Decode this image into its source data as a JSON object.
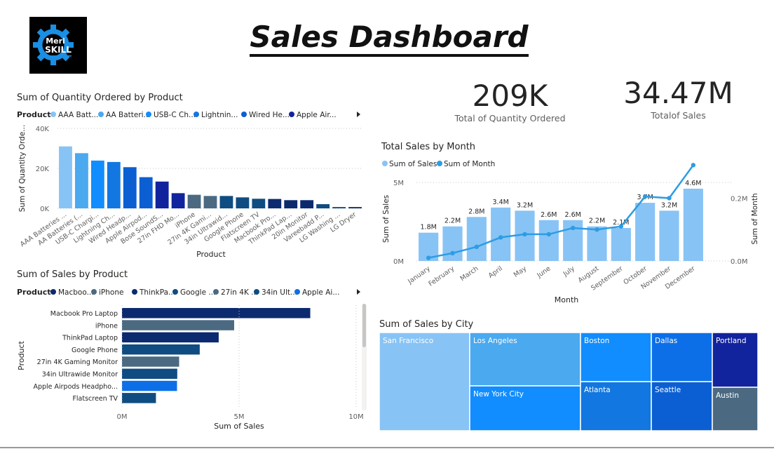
{
  "header": {
    "title": "Sales Dashboard",
    "logo_line1": "Meri",
    "logo_line2": "SKILL"
  },
  "kpis": [
    {
      "value": "209K",
      "label": "Total of Quantity Ordered"
    },
    {
      "value": "34.47M",
      "label": "Totalof Sales"
    }
  ],
  "colors": {
    "light": "#88c3f5",
    "c2": "#4aa9ef",
    "c3": "#118dff",
    "c4": "#1277e0",
    "c5": "#0b5fd2",
    "navy": "#12239e",
    "dark_navy": "#0c2a6f",
    "slate": "#4b6a82",
    "teal": "#0f4c81",
    "line": "#2d9de3",
    "accent_blue": "#0d6fe8"
  },
  "chart_data": [
    {
      "id": "qty",
      "type": "bar",
      "title": "Sum of Quantity Ordered by Product",
      "legend_title": "Product",
      "legend": [
        "AAA Batt...",
        "AA Batteri...",
        "USB-C Ch...",
        "Lightnin...",
        "Wired He...",
        "Apple Air..."
      ],
      "categories": [
        "AAA Batteries ...",
        "AA Batteries (...",
        "USB-C Chargi...",
        "Lightning Ch...",
        "Wired Headp...",
        "Apple Airpod...",
        "Bose SoundS...",
        "27in FHD Mo...",
        "iPhone",
        "27in 4K Gami...",
        "34in Ultrawid...",
        "Google Phone",
        "Flatscreen TV",
        "Macbook Pro...",
        "ThinkPad Lap...",
        "20in Monitor",
        "Vareebadd P...",
        "LG Washing ...",
        "LG Dryer"
      ],
      "values": [
        31000,
        27600,
        23900,
        23200,
        20600,
        15600,
        13400,
        7600,
        6800,
        6200,
        6200,
        5500,
        4800,
        4700,
        4100,
        4100,
        2100,
        660,
        650
      ],
      "xlabel": "Product",
      "ylabel": "Sum of Quantity Orde...",
      "yticks": [
        "0K",
        "20K",
        "40K"
      ],
      "ylim": [
        0,
        40000
      ]
    },
    {
      "id": "month",
      "type": "bar",
      "title": "Total Sales by Month",
      "legend": [
        "Sum of Sales",
        "Sum of Month"
      ],
      "categories": [
        "January",
        "February",
        "March",
        "April",
        "May",
        "June",
        "July",
        "August",
        "September",
        "October",
        "November",
        "December"
      ],
      "series": [
        {
          "name": "Sum of Sales",
          "type": "bar",
          "values": [
            1.8,
            2.2,
            2.8,
            3.4,
            3.2,
            2.6,
            2.6,
            2.2,
            2.1,
            3.7,
            3.2,
            4.6
          ],
          "labels": [
            "1.8M",
            "2.2M",
            "2.8M",
            "3.4M",
            "3.2M",
            "2.6M",
            "2.6M",
            "2.2M",
            "2.1M",
            "3.7M",
            "3.2M",
            "4.6M"
          ]
        },
        {
          "name": "Sum of Month",
          "type": "line",
          "values": [
            0.01,
            0.025,
            0.045,
            0.075,
            0.085,
            0.085,
            0.105,
            0.1,
            0.11,
            0.205,
            0.2,
            0.305
          ]
        }
      ],
      "xlabel": "Month",
      "ylabel": "Sum of Sales",
      "y2label": "Sum of Month",
      "yticks": [
        "0M",
        "5M"
      ],
      "y2ticks": [
        "0.0M",
        "0.2M"
      ],
      "ylim": [
        0,
        5
      ],
      "y2lim": [
        0,
        0.25
      ]
    },
    {
      "id": "salesprod",
      "type": "bar",
      "orientation": "horizontal",
      "title": "Sum of Sales by Product",
      "legend_title": "Product",
      "legend": [
        "Macboo...",
        "iPhone",
        "ThinkPa...",
        "Google ...",
        "27in 4K ...",
        "34in Ult...",
        "Apple Ai..."
      ],
      "categories": [
        "Macbook Pro Laptop",
        "iPhone",
        "ThinkPad Laptop",
        "Google Phone",
        "27in 4K Gaming Monitor",
        "34in Ultrawide Monitor",
        "Apple Airpods Headpho...",
        "Flatscreen TV"
      ],
      "values": [
        8.04,
        4.79,
        4.13,
        3.32,
        2.44,
        2.36,
        2.35,
        1.45
      ],
      "xlabel": "Sum of Sales",
      "ylabel": "Product",
      "xticks": [
        "0M",
        "5M",
        "10M"
      ],
      "xlim": [
        0,
        10
      ]
    },
    {
      "id": "city",
      "type": "treemap",
      "title": "Sum of Sales by City",
      "cells": [
        {
          "name": "San Francisco",
          "value": 8.26
        },
        {
          "name": "Los Angeles",
          "value": 5.45
        },
        {
          "name": "New York City",
          "value": 4.66
        },
        {
          "name": "Boston",
          "value": 3.66
        },
        {
          "name": "Atlanta",
          "value": 2.8
        },
        {
          "name": "Dallas",
          "value": 2.77
        },
        {
          "name": "Seattle",
          "value": 2.75
        },
        {
          "name": "Portland",
          "value": 2.32
        },
        {
          "name": "Austin",
          "value": 1.82
        }
      ]
    }
  ]
}
